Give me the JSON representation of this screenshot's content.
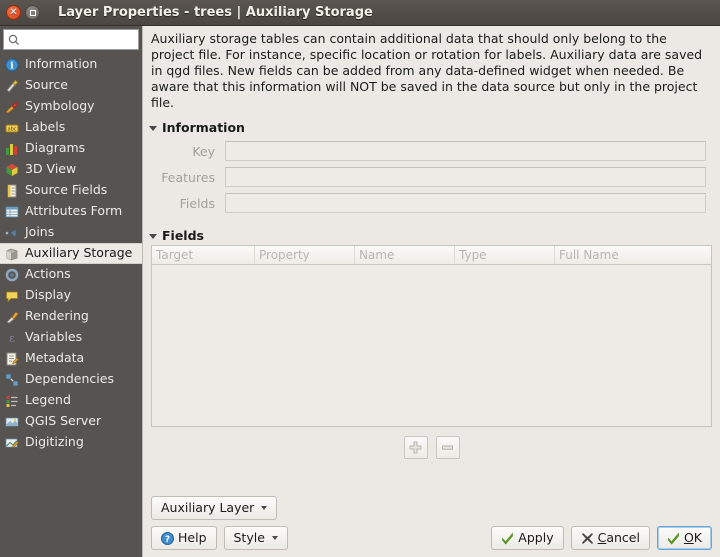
{
  "window": {
    "title": "Layer Properties - trees | Auxiliary Storage",
    "close_icon": "close-icon",
    "maximize_icon": "maximize-icon"
  },
  "sidebar": {
    "search": {
      "value": "",
      "placeholder": "",
      "icon": "search-icon"
    },
    "items": [
      {
        "label": "Information",
        "icon": "information-icon",
        "selected": false
      },
      {
        "label": "Source",
        "icon": "source-icon",
        "selected": false
      },
      {
        "label": "Symbology",
        "icon": "symbology-icon",
        "selected": false
      },
      {
        "label": "Labels",
        "icon": "labels-icon",
        "selected": false
      },
      {
        "label": "Diagrams",
        "icon": "diagrams-icon",
        "selected": false
      },
      {
        "label": "3D View",
        "icon": "3d-view-icon",
        "selected": false
      },
      {
        "label": "Source Fields",
        "icon": "source-fields-icon",
        "selected": false
      },
      {
        "label": "Attributes Form",
        "icon": "attributes-form-icon",
        "selected": false
      },
      {
        "label": "Joins",
        "icon": "joins-icon",
        "selected": false
      },
      {
        "label": "Auxiliary Storage",
        "icon": "auxiliary-storage-icon",
        "selected": true
      },
      {
        "label": "Actions",
        "icon": "actions-icon",
        "selected": false
      },
      {
        "label": "Display",
        "icon": "display-icon",
        "selected": false
      },
      {
        "label": "Rendering",
        "icon": "rendering-icon",
        "selected": false
      },
      {
        "label": "Variables",
        "icon": "variables-icon",
        "selected": false
      },
      {
        "label": "Metadata",
        "icon": "metadata-icon",
        "selected": false
      },
      {
        "label": "Dependencies",
        "icon": "dependencies-icon",
        "selected": false
      },
      {
        "label": "Legend",
        "icon": "legend-icon",
        "selected": false
      },
      {
        "label": "QGIS Server",
        "icon": "qgis-server-icon",
        "selected": false
      },
      {
        "label": "Digitizing",
        "icon": "digitizing-icon",
        "selected": false
      }
    ]
  },
  "main": {
    "description": "Auxiliary storage tables can contain additional data that should only belong to the project file. For instance, specific location or rotation for labels. Auxiliary data are saved in qgd files. New fields can be added from any data-defined widget when needed. Be aware that this information will NOT be saved in the data source but only in the project file.",
    "information": {
      "title": "Information",
      "expanded": true,
      "rows": [
        {
          "label": "Key",
          "value": "",
          "enabled": false
        },
        {
          "label": "Features",
          "value": "",
          "enabled": false
        },
        {
          "label": "Fields",
          "value": "",
          "enabled": false
        }
      ]
    },
    "fields": {
      "title": "Fields",
      "expanded": true,
      "columns": [
        "Target",
        "Property",
        "Name",
        "Type",
        "Full Name"
      ],
      "rows": [],
      "add_button": {
        "label": "+",
        "icon": "add-icon",
        "enabled": false
      },
      "remove_button": {
        "label": "-",
        "icon": "remove-icon",
        "enabled": false
      }
    }
  },
  "footer": {
    "auxiliary_layer_button": {
      "label": "Auxiliary Layer",
      "icon": "chevron-down-icon"
    },
    "help_button": {
      "label": "Help",
      "icon": "help-icon"
    },
    "style_button": {
      "label": "Style",
      "icon": "chevron-down-icon"
    },
    "apply_button": {
      "label": "Apply",
      "icon": "check-icon"
    },
    "cancel_button": {
      "label": "Cancel",
      "icon": "cross-icon"
    },
    "ok_button": {
      "label": "OK",
      "icon": "check-icon",
      "focused": true
    }
  },
  "colors": {
    "titlebar": "#4b4641",
    "sidebar_bg": "#575350",
    "content_bg": "#ece9e4",
    "selected_bg": "#edeae5",
    "accent_green": "#6ab023",
    "close_red": "#d44316",
    "focus_blue": "#6aa5d8"
  }
}
